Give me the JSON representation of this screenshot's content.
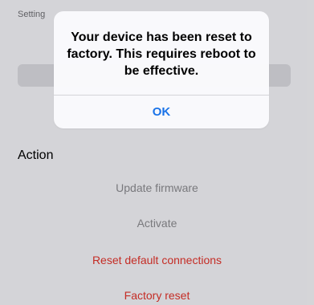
{
  "background": {
    "setting_label": "Setting",
    "section_title": "Action",
    "actions": [
      {
        "label": "Update firmware",
        "color": "#8a8a8f"
      },
      {
        "label": "Activate",
        "color": "#8a8a8f"
      },
      {
        "label": "Reset default connections",
        "color": "#e0332b"
      },
      {
        "label": "Factory reset",
        "color": "#e0332b"
      }
    ]
  },
  "alert": {
    "message": "Your device has been reset to factory. This requires reboot to be effective.",
    "ok_label": "OK",
    "ok_color": "#1a73e8"
  }
}
